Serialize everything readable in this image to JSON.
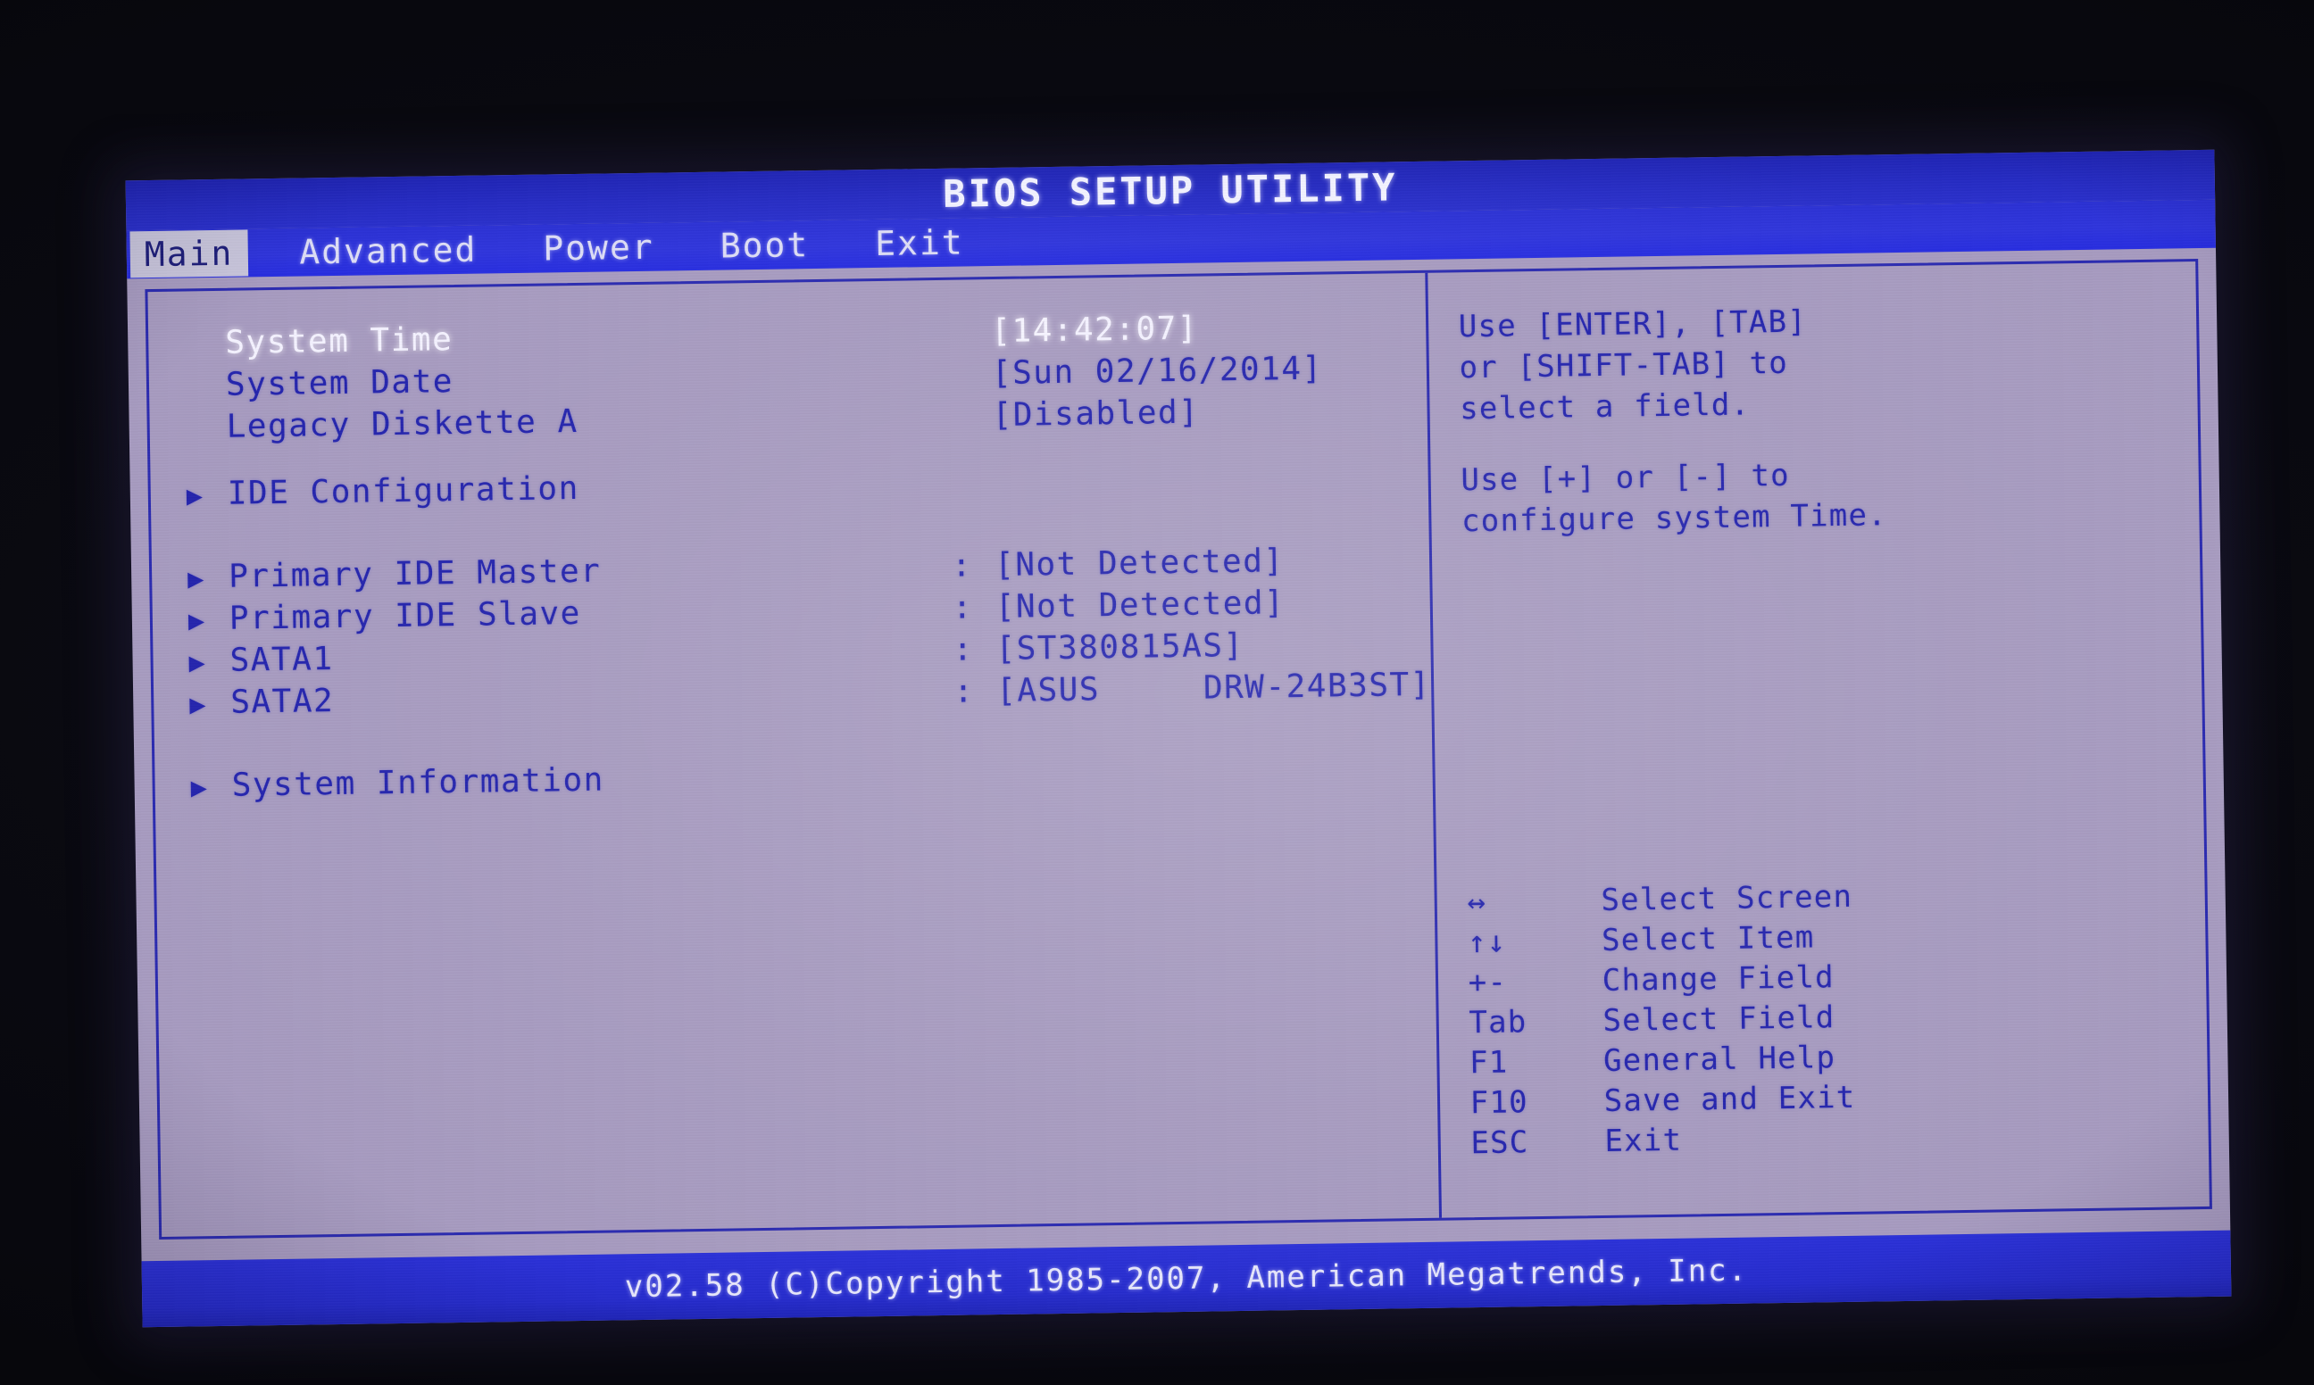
{
  "header": {
    "title": "BIOS SETUP UTILITY"
  },
  "menu": {
    "items": [
      {
        "label": "Main",
        "active": true
      },
      {
        "label": "Advanced",
        "active": false
      },
      {
        "label": "Power",
        "active": false
      },
      {
        "label": "Boot",
        "active": false
      },
      {
        "label": "Exit",
        "active": false
      }
    ]
  },
  "main": {
    "settings": [
      {
        "arrow": "",
        "label": "System Time",
        "colon": "",
        "value_pre": "[",
        "value_hl": "14",
        "value_post": ":42:07]",
        "selected": true
      },
      {
        "arrow": "",
        "label": "System Date",
        "colon": "",
        "value": "[Sun 02/16/2014]",
        "selected": false
      },
      {
        "arrow": "",
        "label": "Legacy Diskette A",
        "colon": "",
        "value": "[Disabled]",
        "selected": false
      }
    ],
    "submenu_group1": [
      {
        "arrow": "▶",
        "label": "IDE Configuration",
        "colon": "",
        "value": ""
      }
    ],
    "devices": [
      {
        "arrow": "▶",
        "label": "Primary IDE Master",
        "colon": ":",
        "value": "[Not Detected]"
      },
      {
        "arrow": "▶",
        "label": "Primary IDE Slave",
        "colon": ":",
        "value": "[Not Detected]"
      },
      {
        "arrow": "▶",
        "label": "SATA1",
        "colon": ":",
        "value": "[ST380815AS]"
      },
      {
        "arrow": "▶",
        "label": "SATA2",
        "colon": ":",
        "value": "[ASUS     DRW-24B3ST]"
      }
    ],
    "submenu_group2": [
      {
        "arrow": "▶",
        "label": "System Information",
        "colon": "",
        "value": ""
      }
    ]
  },
  "help": {
    "paragraphs": [
      "Use [ENTER], [TAB]\nor [SHIFT-TAB] to\nselect a field.",
      "Use [+] or [-] to\nconfigure system Time."
    ],
    "legend": [
      {
        "key": "↔",
        "desc": "Select Screen"
      },
      {
        "key": "↑↓",
        "desc": "Select Item"
      },
      {
        "key": "+-",
        "desc": "Change Field"
      },
      {
        "key": "Tab",
        "desc": "Select Field"
      },
      {
        "key": "F1",
        "desc": "General Help"
      },
      {
        "key": "F10",
        "desc": "Save and Exit"
      },
      {
        "key": "ESC",
        "desc": "Exit"
      }
    ]
  },
  "footer": {
    "copyright": "v02.58 (C)Copyright 1985-2007, American Megatrends, Inc."
  },
  "colors": {
    "screen_bg": "#a79bc0",
    "bar_blue": "#2b31d8",
    "text_blue": "#2424ad",
    "text_white": "#f4f2ff",
    "tab_active_bg": "#c9c6dc"
  }
}
